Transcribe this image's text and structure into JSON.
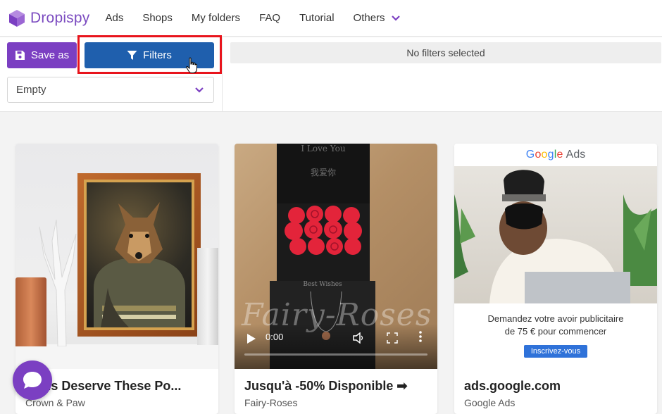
{
  "nav": {
    "logo_text": "Dropispy",
    "items": [
      {
        "label": "Ads"
      },
      {
        "label": "Shops"
      },
      {
        "label": "My folders"
      },
      {
        "label": "FAQ"
      },
      {
        "label": "Tutorial"
      },
      {
        "label": "Others"
      }
    ],
    "others_icon": "chevron-down-icon"
  },
  "toolbar": {
    "save_label": "Save as",
    "save_icon": "floppy-disk-icon",
    "filters_label": "Filters",
    "filters_icon": "funnel-icon",
    "select_value": "Empty",
    "no_filters_text": "No filters selected",
    "accent_purple": "#7b3fc2",
    "filters_blue": "#1f5fad",
    "highlight_red": "#e8141c"
  },
  "cards": [
    {
      "title": "Walls Deserve These Po...",
      "subtitle": "Crown & Paw",
      "media": "framed-dog-portrait-image"
    },
    {
      "title": "Jusqu'à -50% Disponible ➡",
      "subtitle": "Fairy-Roses",
      "media": "video",
      "lid_text_1": "I Love You",
      "lid_text_2": "我爱你",
      "drawer_text": "Best Wishes",
      "watermark": "Fairy-Roses",
      "video_time": "0:00",
      "video_progress": 0
    },
    {
      "title": "ads.google.com",
      "subtitle": "Google Ads",
      "ad_header_google": "Google",
      "ad_header_ads": "Ads",
      "ad_text_line1": "Demandez votre avoir publicitaire",
      "ad_text_line2": "de 75 € pour commencer",
      "ad_button": "Inscrivez-vous"
    }
  ],
  "chat_icon": "chat-bubble-icon"
}
